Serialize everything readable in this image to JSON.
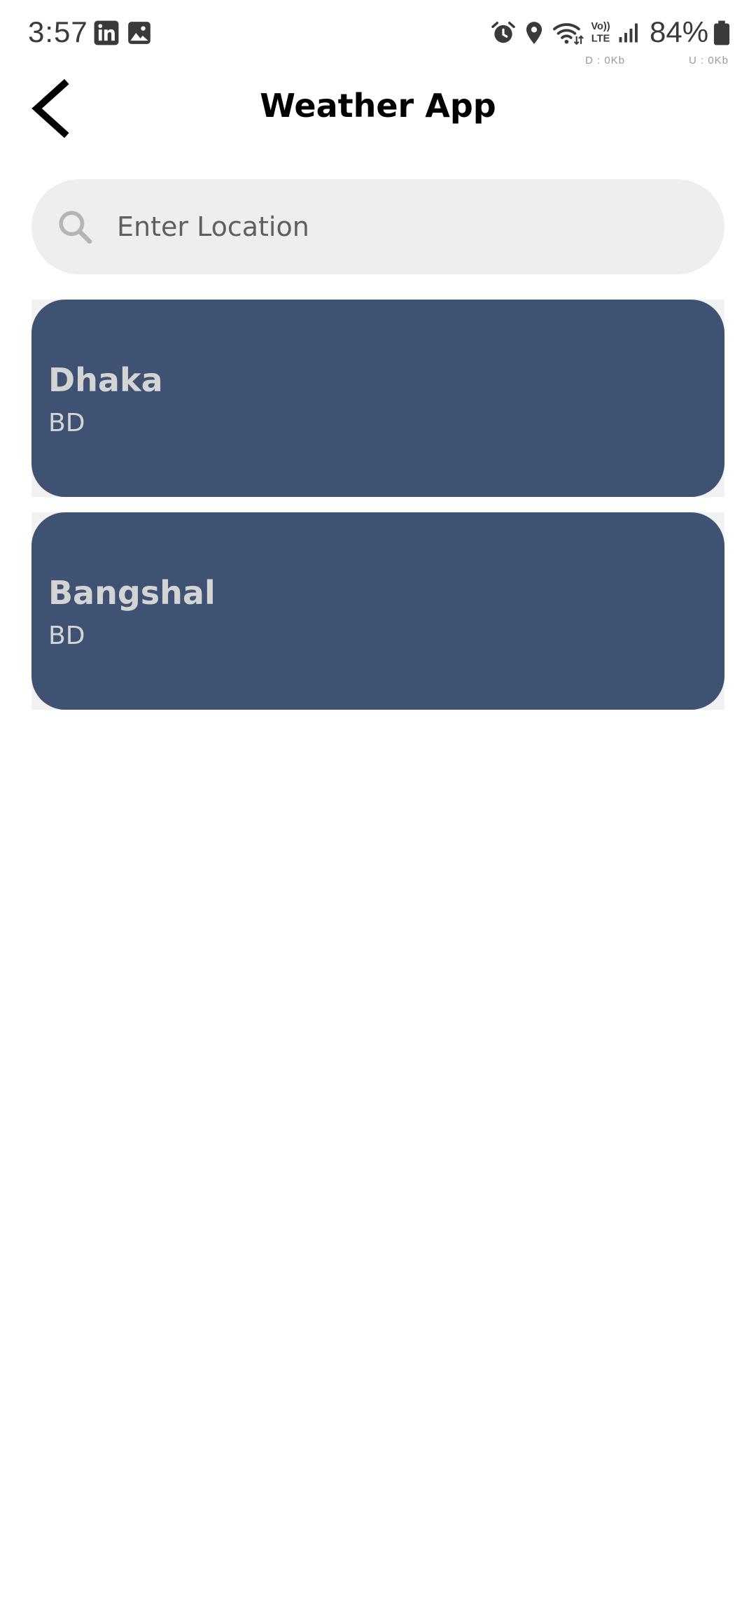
{
  "status_bar": {
    "time": "3:57",
    "battery": "84%",
    "download_speed": "D : 0Kb",
    "upload_speed": "U : 0Kb",
    "icons": [
      "linkedin-icon",
      "gallery-icon",
      "alarm-icon",
      "location-pin-icon",
      "wifi-icon",
      "volte-icon",
      "signal-icon",
      "battery-icon"
    ],
    "volte_text_top": "Vo))",
    "volte_text_bottom": "LTE"
  },
  "app_bar": {
    "title": "Weather App",
    "back_icon": "chevron-left-icon"
  },
  "search": {
    "placeholder": "Enter Location",
    "value": "",
    "icon": "search-icon"
  },
  "locations": [
    {
      "city": "Dhaka",
      "country": "BD"
    },
    {
      "city": "Bangshal",
      "country": "BD"
    }
  ],
  "colors": {
    "card_background": "#3f5273",
    "card_text": "#d4d4d4",
    "search_background": "#efeeed",
    "page_background": "#ffffff"
  }
}
